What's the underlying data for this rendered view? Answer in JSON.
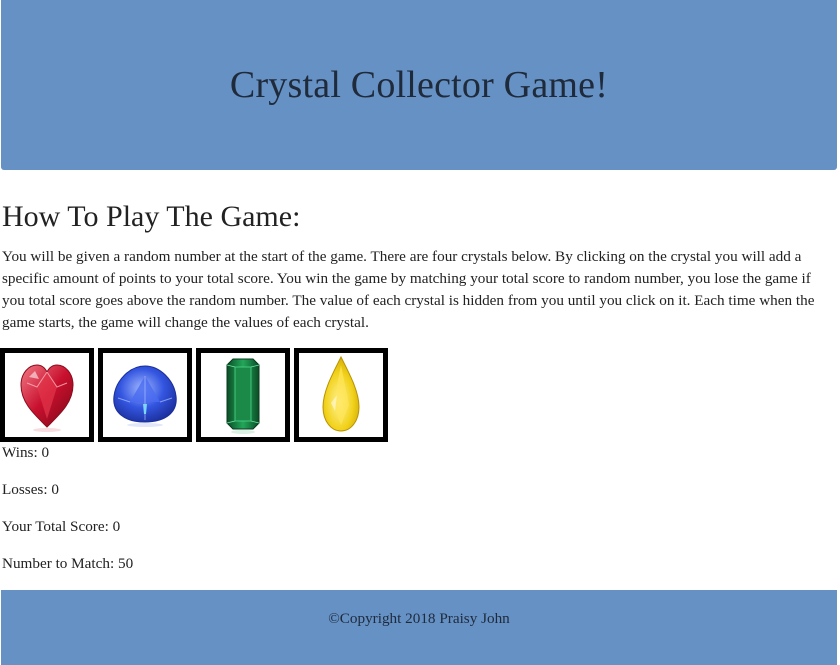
{
  "header": {
    "title": "Crystal Collector Game!"
  },
  "howto": {
    "title": "How To Play The Game:",
    "text": "You will be given a random number at the start of the game. There are four crystals below. By clicking on the crystal you will add a specific amount of points to your total score. You win the game by matching your total score to random number, you lose the game if you total score goes above the random number. The value of each crystal is hidden from you until you click on it. Each time when the game starts, the game will change the values of each crystal."
  },
  "crystals": [
    {
      "icon": "red-heart-crystal-icon",
      "color": "#c8102e"
    },
    {
      "icon": "blue-trillion-crystal-icon",
      "color": "#2b4fd6"
    },
    {
      "icon": "green-emerald-crystal-icon",
      "color": "#0f7a3c"
    },
    {
      "icon": "yellow-pear-crystal-icon",
      "color": "#f2d21b"
    }
  ],
  "stats": {
    "wins": "Wins: 0",
    "losses": "Losses: 0",
    "total_score": "Your Total Score: 0",
    "number_to_match": "Number to Match: 50"
  },
  "footer": {
    "copyright": "©Copyright 2018 Praisy John"
  },
  "colors": {
    "header_bg": "#6591c5",
    "footer_bg": "#6591c5"
  }
}
